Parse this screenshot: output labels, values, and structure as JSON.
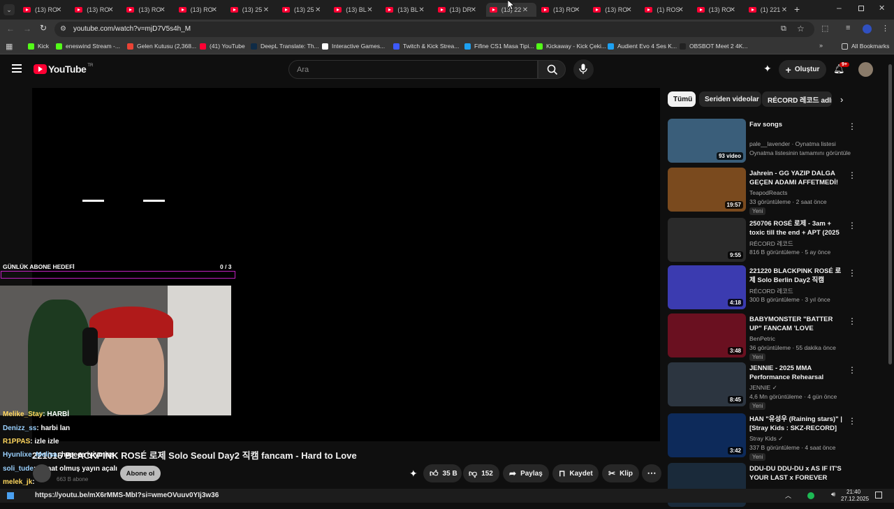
{
  "browser": {
    "tabs": [
      {
        "label": "(13) RO"
      },
      {
        "label": "(13) RO"
      },
      {
        "label": "(13) RO"
      },
      {
        "label": "(13) RO"
      },
      {
        "label": "(13) 25"
      },
      {
        "label": "(13) 25"
      },
      {
        "label": "(13) BL"
      },
      {
        "label": "(13) BL"
      },
      {
        "label": "(13) DR"
      },
      {
        "label": "(13) 22"
      },
      {
        "label": "(13) RO"
      },
      {
        "label": "(13) RO"
      },
      {
        "label": "(1) ROS"
      },
      {
        "label": "(13) RO"
      },
      {
        "label": "(1) 221"
      }
    ],
    "active_tab_index": 9,
    "url": "youtube.com/watch?v=mjD7V5s4h_M",
    "bookmarks": [
      {
        "label": "Kick",
        "color": "#53fc18"
      },
      {
        "label": "eneswind Stream -...",
        "color": "#53fc18"
      },
      {
        "label": "Gelen Kutusu (2,368...",
        "color": "#ea4335"
      },
      {
        "label": "(41) YouTube",
        "color": "#ff0033"
      },
      {
        "label": "DeepL Translate: Th...",
        "color": "#0f2b46"
      },
      {
        "label": "Interactive Games...",
        "color": "#ffffff"
      },
      {
        "label": "Twitch & Kick Strea...",
        "color": "#3d5afe"
      },
      {
        "label": "Fifine CS1 Masa Tipi...",
        "color": "#1da1f2"
      },
      {
        "label": "Kickaway - Kick Çeki...",
        "color": "#53fc18"
      },
      {
        "label": "Audient Evo 4 Ses K...",
        "color": "#1da1f2"
      },
      {
        "label": "OBSBOT Meet 2 4K...",
        "color": "#222222"
      }
    ],
    "all_bookmarks": "All Bookmarks"
  },
  "youtube": {
    "logo": "YouTube",
    "region": "TR",
    "search_placeholder": "Ara",
    "create_label": "Oluştur",
    "notif_count": "9+"
  },
  "overlay": {
    "goal_label": "GÜNLÜK ABONE HEDEFİ",
    "goal_value": "0 / 3",
    "chat": [
      {
        "user": "Melike_Stay",
        "msg": ": HARBİ",
        "color": "#ffd75e"
      },
      {
        "user": "Denizz_ss",
        "msg": ": harbi lan",
        "color": "#9ad1ff"
      },
      {
        "user": "R1PPAS",
        "msg": ": izle izle",
        "color": "#ffd75e"
      },
      {
        "user": "Hyunlixe_Melisa",
        "msg": ": heeeee iyiymiss",
        "color": "#9ad1ff"
      },
      {
        "user": "soli_tude",
        "msg": ": 1 saat olmuş yayın açalı",
        "color": "#9ad1ff"
      },
      {
        "user": "melek_jk",
        "msg": ":",
        "color": "#ffd75e"
      }
    ],
    "link_line": "https://youtu.be/mX6rMMS-MbI?si=wmeOVuuv0YIj3w36"
  },
  "video": {
    "title": "221016 BLACKPINK ROSÉ 로제 Solo Seoul Day2 직캠 fancam - Hard to Love",
    "subscribe": "Abone ol",
    "subs_count": "663 B abone",
    "likes": "35 B",
    "dislikes": "152",
    "share": "Paylaş",
    "save": "Kaydet",
    "clip": "Klip"
  },
  "chips": [
    "Tümü",
    "Seriden videolar",
    "RÉCORD 레코드 adlı y"
  ],
  "recommendations": [
    {
      "title": "Fav songs",
      "channel": "pale__lavender · Oynatma listesi",
      "meta": "Oynatma listesinin tamamını görüntüle",
      "dur": "93 video",
      "badge": "",
      "thumb": "#3a5e7a"
    },
    {
      "title": "Jahrein - GG YAZIP DALGA GEÇEN ADAMI AFFETMEDİ! A...",
      "channel": "TeapodReacts",
      "meta": "33 görüntüleme · 2 saat önce",
      "dur": "19:57",
      "badge": "Yeni",
      "thumb": "#7a4a1e"
    },
    {
      "title": "250706 ROSÉ 로제 - 3am + toxic till the end + APT (2025 ...",
      "channel": "RÉCORD 레코드",
      "meta": "816 B görüntüleme · 5 ay önce",
      "dur": "9:55",
      "badge": "",
      "thumb": "#2a2a2a"
    },
    {
      "title": "221220 BLACKPINK ROSÉ 로제 Solo Berlin Day2 직캠 fancam ...",
      "channel": "RÉCORD 레코드",
      "meta": "300 B görüntüleme · 3 yıl önce",
      "dur": "4:18",
      "badge": "",
      "thumb": "#3b3bb0"
    },
    {
      "title": "BABYMONSTER \"BATTER UP\" FANCAM 'LOVE MONSTER' IN ...",
      "channel": "BenPetric",
      "meta": "36 görüntüleme · 55 dakika önce",
      "dur": "3:48",
      "badge": "Yeni",
      "thumb": "#6a1020"
    },
    {
      "title": "JENNIE - 2025 MMA Performance Rehearsal",
      "channel": "JENNIE ✓",
      "meta": "4,6 Mn görüntüleme · 4 gün önce",
      "dur": "8:45",
      "badge": "Yeni",
      "thumb": "#2c3540"
    },
    {
      "title": "HAN \"유성우 (Raining stars)\" | [Stray Kids : SKZ-RECORD]",
      "channel": "Stray Kids ✓",
      "meta": "337 B görüntüleme · 4 saat önce",
      "dur": "3:42",
      "badge": "Yeni",
      "thumb": "#0d2a5a"
    },
    {
      "title": "DDU-DU DDU-DU x AS IF IT'S YOUR LAST x FOREVER YOUN...",
      "channel": "",
      "meta": "",
      "dur": "",
      "badge": "",
      "thumb": "#1a2a3a"
    }
  ],
  "taskbar": {
    "time": "21:40",
    "date": "27.12.2025"
  }
}
